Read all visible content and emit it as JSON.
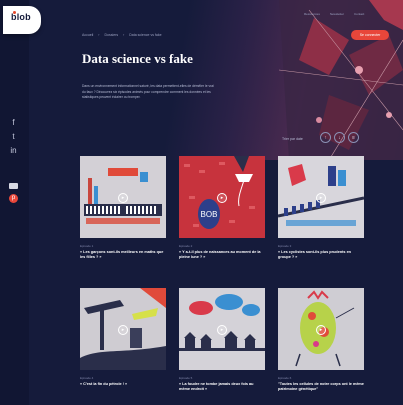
{
  "brand": {
    "logo": "blob"
  },
  "top_nav": [
    "Ressources",
    "Newsletter",
    "Contact"
  ],
  "top_cta": "Se connecter",
  "breadcrumb": [
    "Accueil",
    "Dossiers",
    "Data science vs fake"
  ],
  "page": {
    "title": "Data science vs fake",
    "intro": "Dans un environnement informationnel saturé, les data permettent-elles de démêler le vrai du faux ? Découvrez six épisodes animés pour comprendre comment les données et les statistiques peuvent éclairer ou tromper."
  },
  "sort": {
    "label": "Trier par date",
    "options": [
      "↑",
      "↓",
      "≡"
    ]
  },
  "share_icons": [
    "facebook-icon",
    "twitter-icon",
    "linkedin-icon",
    "mail-icon",
    "pinterest-icon"
  ],
  "cards": [
    {
      "date": "Episode 1",
      "title": "« Les garçons sont-ils meilleurs en maths que les filles ? »"
    },
    {
      "date": "Episode 2",
      "title": "« Y a-t-il plus de naissances au moment de la pleine lune ? »"
    },
    {
      "date": "Episode 3",
      "title": "« Les cyclistes sont-ils plus prudents en groupe ? »"
    },
    {
      "date": "Episode 4",
      "title": "« C'est la fin du pétrole ! »"
    },
    {
      "date": "Episode 5",
      "title": "« La foudre ne tombe jamais deux fois au même endroit »"
    },
    {
      "date": "Episode 6",
      "title": "\"Toutes les cellules de notre corps ont le même patrimoine génétique\""
    }
  ],
  "colors": {
    "background": "#151b3b",
    "accent": "#e8463a",
    "text": "#ffffff"
  }
}
